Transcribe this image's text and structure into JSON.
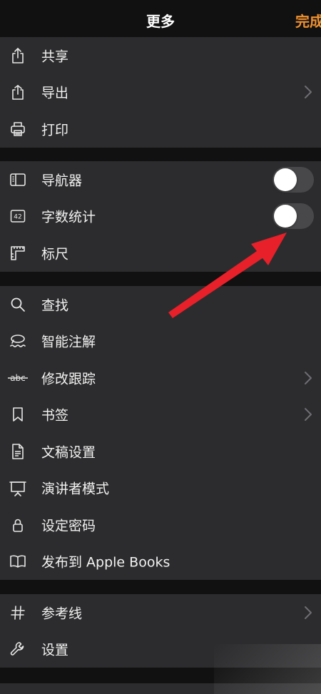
{
  "header": {
    "title": "更多",
    "done_label": "完成"
  },
  "colors": {
    "accent": "#f0912f",
    "arrow": "#e8202a",
    "row_bg": "#2c2c2e",
    "gap_bg": "#111111"
  },
  "groups": [
    {
      "items": [
        {
          "label": "共享",
          "icon": "share-icon"
        },
        {
          "label": "导出",
          "icon": "export-icon",
          "chevron": true
        },
        {
          "label": "打印",
          "icon": "printer-icon"
        }
      ]
    },
    {
      "items": [
        {
          "label": "导航器",
          "icon": "sidebar-icon",
          "toggle": false
        },
        {
          "label": "字数统计",
          "icon": "word-count-icon",
          "icon_text": "42",
          "toggle": false
        },
        {
          "label": "标尺",
          "icon": "ruler-icon"
        }
      ]
    },
    {
      "items": [
        {
          "label": "查找",
          "icon": "search-icon"
        },
        {
          "label": "智能注解",
          "icon": "smart-annotation-icon"
        },
        {
          "label": "修改跟踪",
          "icon": "track-changes-icon",
          "icon_text": "abc",
          "chevron": true
        },
        {
          "label": "书签",
          "icon": "bookmark-icon",
          "chevron": true
        },
        {
          "label": "文稿设置",
          "icon": "document-icon"
        },
        {
          "label": "演讲者模式",
          "icon": "presenter-icon"
        },
        {
          "label": "设定密码",
          "icon": "lock-icon"
        },
        {
          "label": "发布到 Apple Books",
          "icon": "book-icon"
        }
      ]
    },
    {
      "items": [
        {
          "label": "参考线",
          "icon": "hashtag-icon",
          "chevron": true
        },
        {
          "label": "设置",
          "icon": "wrench-icon"
        }
      ]
    }
  ]
}
